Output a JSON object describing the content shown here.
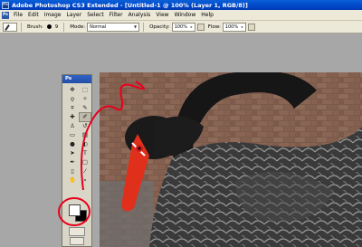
{
  "titlebar": {
    "app_icon": "Ps",
    "title": "Adobe Photoshop CS3 Extended - [Untitled-1 @ 100% (Layer 1, RGB/8)]"
  },
  "menubar": {
    "logo": "Ps",
    "items": [
      "File",
      "Edit",
      "Image",
      "Layer",
      "Select",
      "Filter",
      "Analysis",
      "View",
      "Window",
      "Help"
    ]
  },
  "options": {
    "brush_label": "Brush:",
    "brush_size": "9",
    "mode_label": "Mode:",
    "mode_value": "Normal",
    "opacity_label": "Opacity:",
    "opacity_value": "100%",
    "flow_label": "Flow:",
    "flow_value": "100%"
  },
  "toolbox": {
    "header": "Ps",
    "tools": [
      {
        "name": "move-tool",
        "glyph": "✥"
      },
      {
        "name": "marquee-tool",
        "glyph": "⬚"
      },
      {
        "name": "lasso-tool",
        "glyph": "ϙ"
      },
      {
        "name": "magic-wand-tool",
        "glyph": "✧"
      },
      {
        "name": "crop-tool",
        "glyph": "⌗"
      },
      {
        "name": "slice-tool",
        "glyph": "✎"
      },
      {
        "name": "healing-brush-tool",
        "glyph": "✚"
      },
      {
        "name": "brush-tool",
        "glyph": "✐"
      },
      {
        "name": "clone-stamp-tool",
        "glyph": "♙"
      },
      {
        "name": "history-brush-tool",
        "glyph": "↺"
      },
      {
        "name": "eraser-tool",
        "glyph": "▭"
      },
      {
        "name": "gradient-tool",
        "glyph": "▤"
      },
      {
        "name": "blur-tool",
        "glyph": "●"
      },
      {
        "name": "dodge-tool",
        "glyph": "◐"
      },
      {
        "name": "path-selection-tool",
        "glyph": "➤"
      },
      {
        "name": "type-tool",
        "glyph": "T"
      },
      {
        "name": "pen-tool",
        "glyph": "✒"
      },
      {
        "name": "shape-tool",
        "glyph": "▢"
      },
      {
        "name": "notes-tool",
        "glyph": "▯"
      },
      {
        "name": "eyedropper-tool",
        "glyph": "⁄"
      },
      {
        "name": "hand-tool",
        "glyph": "✋"
      },
      {
        "name": "zoom-tool",
        "glyph": "⌕"
      }
    ],
    "foreground_color": "#ffffff",
    "background_color": "#000000"
  },
  "colors": {
    "annotation_red": "#e8001c",
    "swan_beak": "#e0301c"
  }
}
